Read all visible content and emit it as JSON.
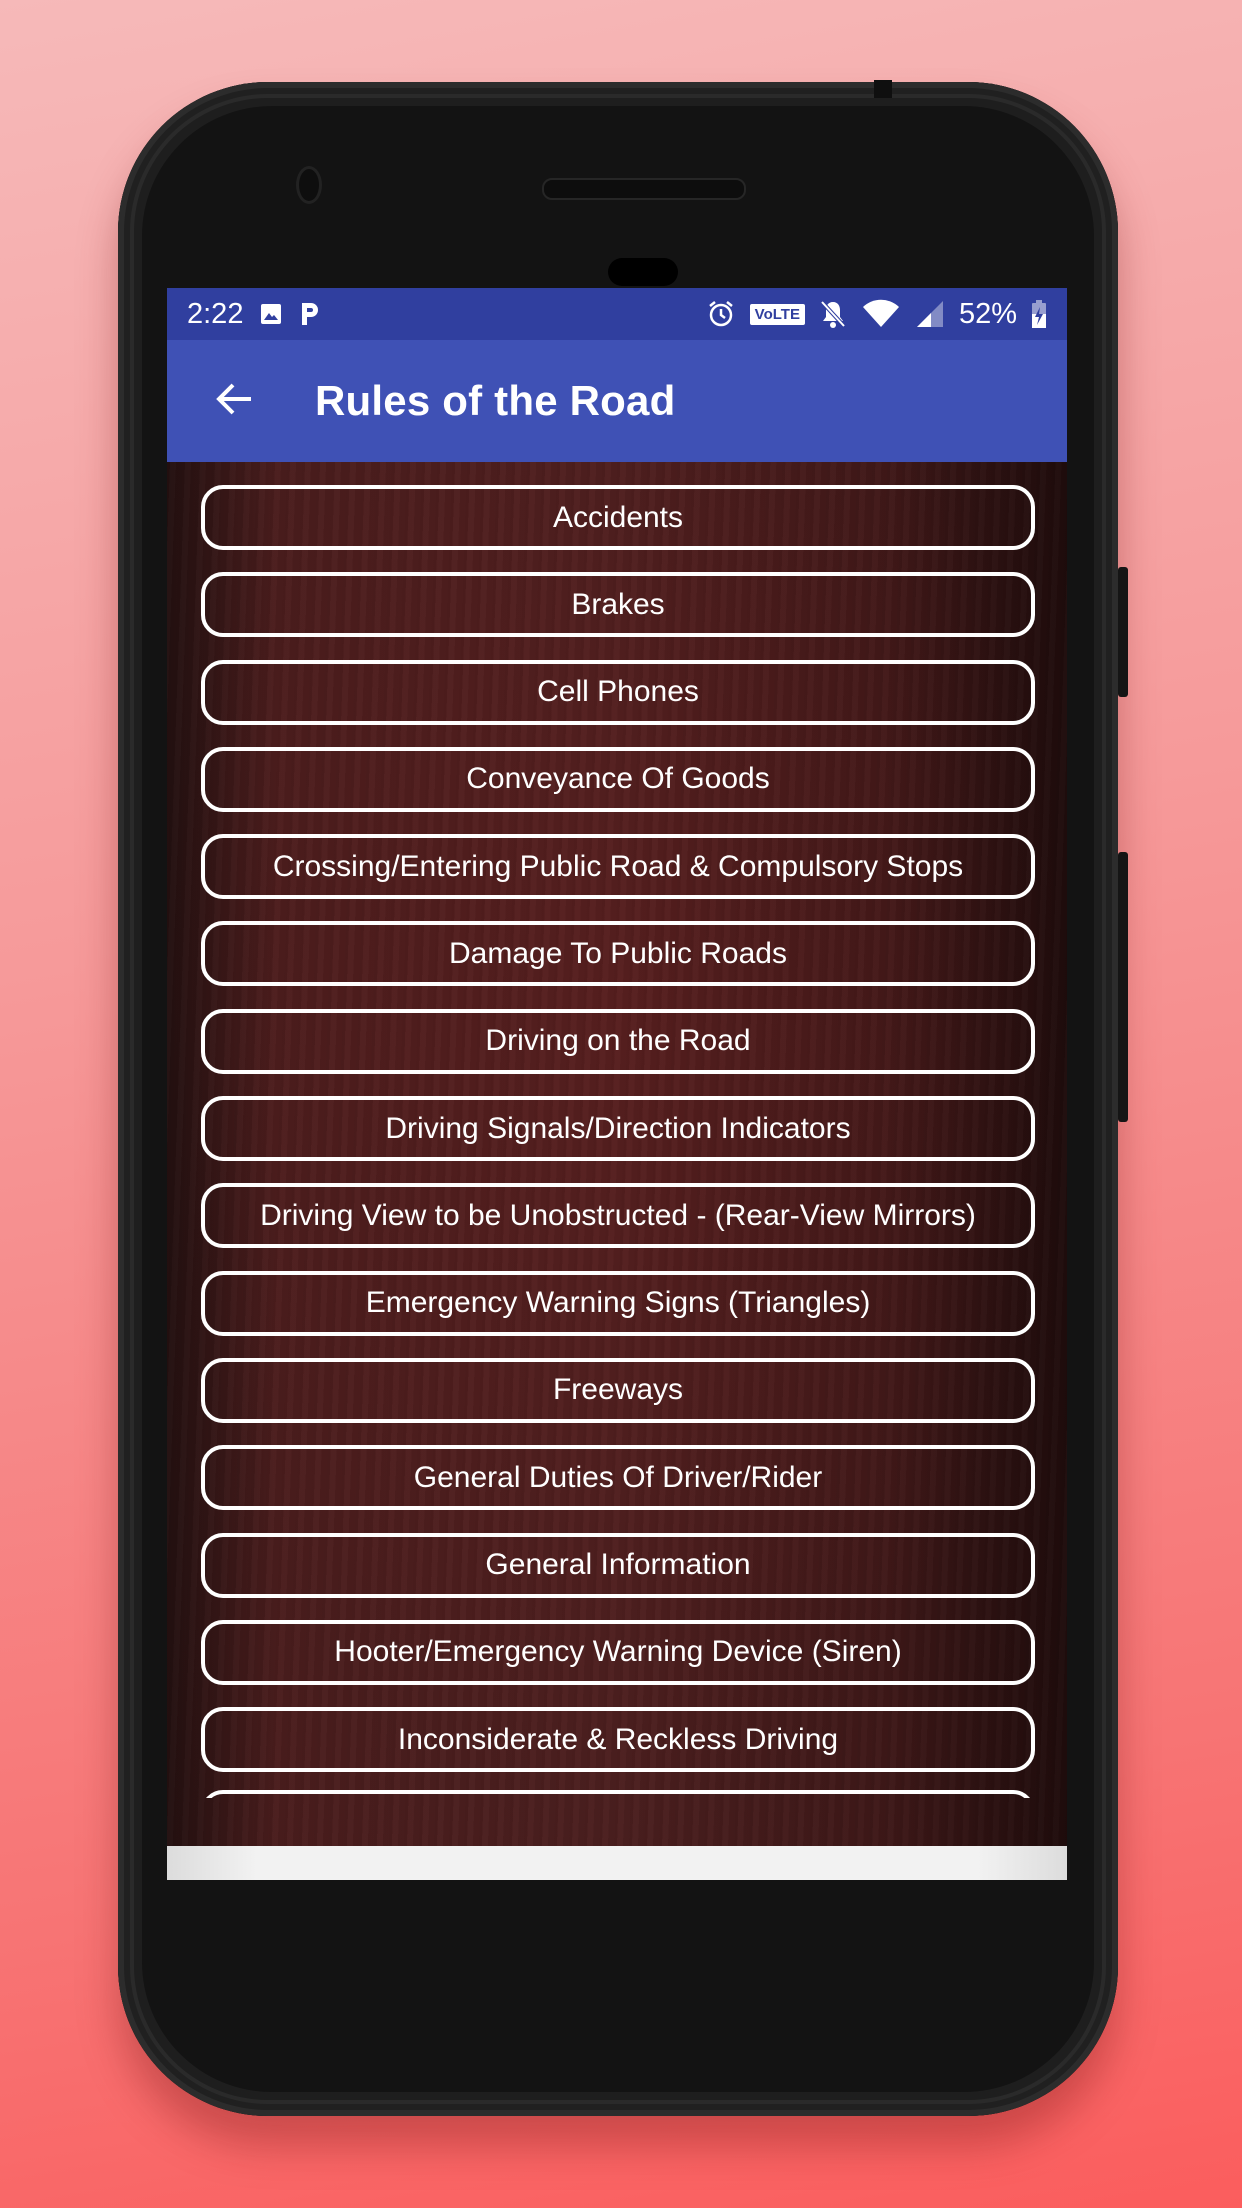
{
  "status_bar": {
    "time": "2:22",
    "left_icons": [
      "image-icon",
      "parking-app-icon"
    ],
    "right_icons": [
      "alarm-icon",
      "volte-badge",
      "notifications-muted-icon",
      "wifi-icon",
      "cellular-signal-icon"
    ],
    "volte_label": "VoLTE",
    "battery_percent": "52%",
    "battery_charging": true
  },
  "app_bar": {
    "back_icon": "arrow-back-icon",
    "title": "Rules of the Road",
    "color": "#3f51b5",
    "status_color": "#303f9f"
  },
  "rules": [
    {
      "label": "Accidents"
    },
    {
      "label": "Brakes"
    },
    {
      "label": "Cell Phones"
    },
    {
      "label": "Conveyance Of Goods"
    },
    {
      "label": "Crossing/Entering Public Road & Compulsory Stops"
    },
    {
      "label": "Damage To Public Roads"
    },
    {
      "label": "Driving on the Road"
    },
    {
      "label": "Driving Signals/Direction Indicators"
    },
    {
      "label": "Driving View to be Unobstructed - (Rear-View Mirrors)"
    },
    {
      "label": "Emergency Warning Signs (Triangles)"
    },
    {
      "label": "Freeways"
    },
    {
      "label": "General Duties Of Driver/Rider"
    },
    {
      "label": "General Information"
    },
    {
      "label": "Hooter/Emergency Warning Device (Siren)"
    },
    {
      "label": "Inconsiderate & Reckless Driving"
    },
    {
      "label": ""
    }
  ]
}
